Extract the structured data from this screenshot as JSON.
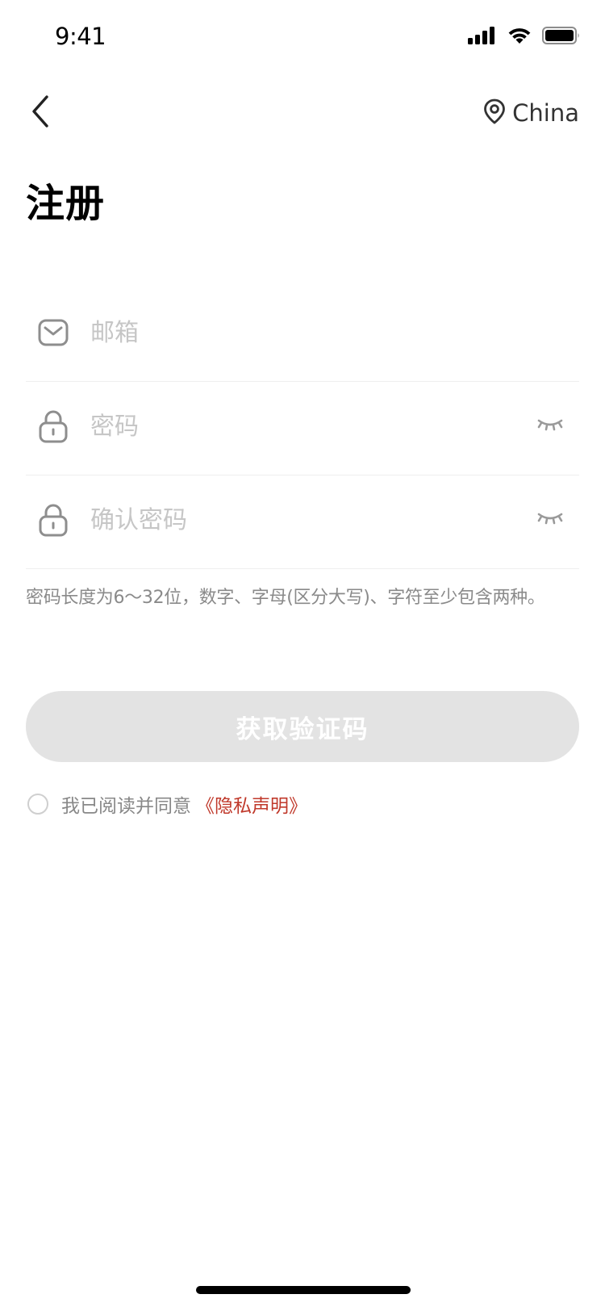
{
  "status_bar": {
    "time": "9:41"
  },
  "nav": {
    "region_label": "China"
  },
  "page": {
    "title": "注册"
  },
  "form": {
    "email": {
      "value": "",
      "placeholder": "邮箱"
    },
    "password": {
      "value": "",
      "placeholder": "密码"
    },
    "confirm_password": {
      "value": "",
      "placeholder": "确认密码"
    },
    "hint": "密码长度为6～32位，数字、字母(区分大写)、字符至少包含两种。",
    "submit_label": "获取验证码"
  },
  "agreement": {
    "checked": false,
    "text": "我已阅读并同意",
    "link_label": "《隐私声明》"
  },
  "colors": {
    "accent_link": "#c0392b",
    "button_disabled": "#e3e3e3",
    "placeholder": "#c6c6c6"
  },
  "icons": {
    "back": "chevron-left-icon",
    "region": "location-pin-icon",
    "email": "mail-icon",
    "password": "lock-icon",
    "visibility": "eye-closed-icon"
  }
}
